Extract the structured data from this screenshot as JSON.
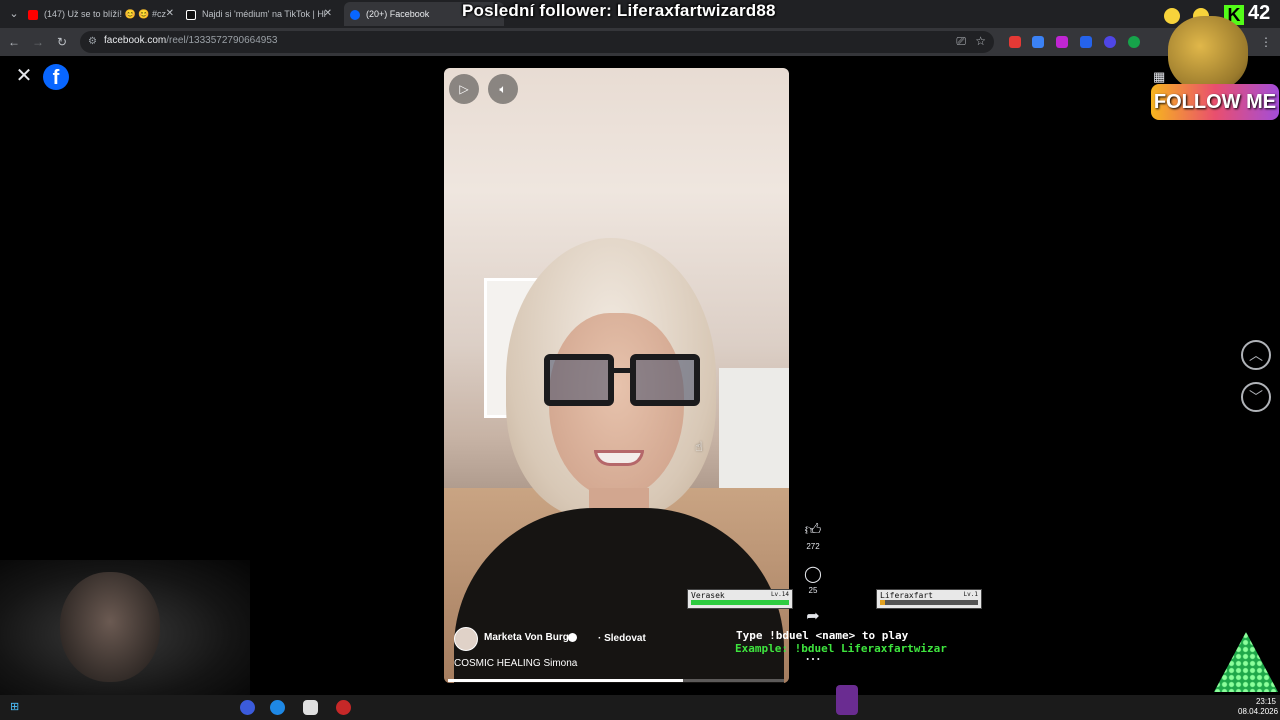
{
  "browser": {
    "tabs": [
      {
        "title": "(147) Už se to blíží! 😊 😊 #cz",
        "icon": "youtube-icon",
        "color": "#ff0000"
      },
      {
        "title": "Najdi si 'médium' na TikTok | Hl",
        "icon": "tiktok-icon",
        "color": "#ffffff"
      },
      {
        "title": "(20+) Facebook",
        "icon": "facebook-icon",
        "color": "#0866ff"
      }
    ],
    "url_domain": "facebook.com",
    "url_path": "/reel/1333572790664953"
  },
  "stream": {
    "title": "Poslední follower: Liferaxfartwizard88",
    "viewer_count": "42",
    "platform_label": "K",
    "follow_me": "FOLLOW ME"
  },
  "reel": {
    "owner": "Marketa Von Burg",
    "follow_label": "Sledovat",
    "caption": "COSMIC HEALING Simona",
    "progress": 0.7,
    "likes": "272",
    "comments": "25"
  },
  "duel": {
    "player1": {
      "name": "Verasek",
      "level": "Lv.14",
      "hp": 1.0
    },
    "player2": {
      "name": "Liferaxfart",
      "level": "Lv.1",
      "hp": 0.05
    },
    "line1": "Type !bduel <name> to play",
    "line2": "Example: !bduel Liferaxfartwizar"
  },
  "taskbar": {
    "time": "23:15",
    "date": "08.04.2026"
  },
  "colors": {
    "facebook_blue": "#0866ff",
    "kick_green": "#53fc18"
  }
}
